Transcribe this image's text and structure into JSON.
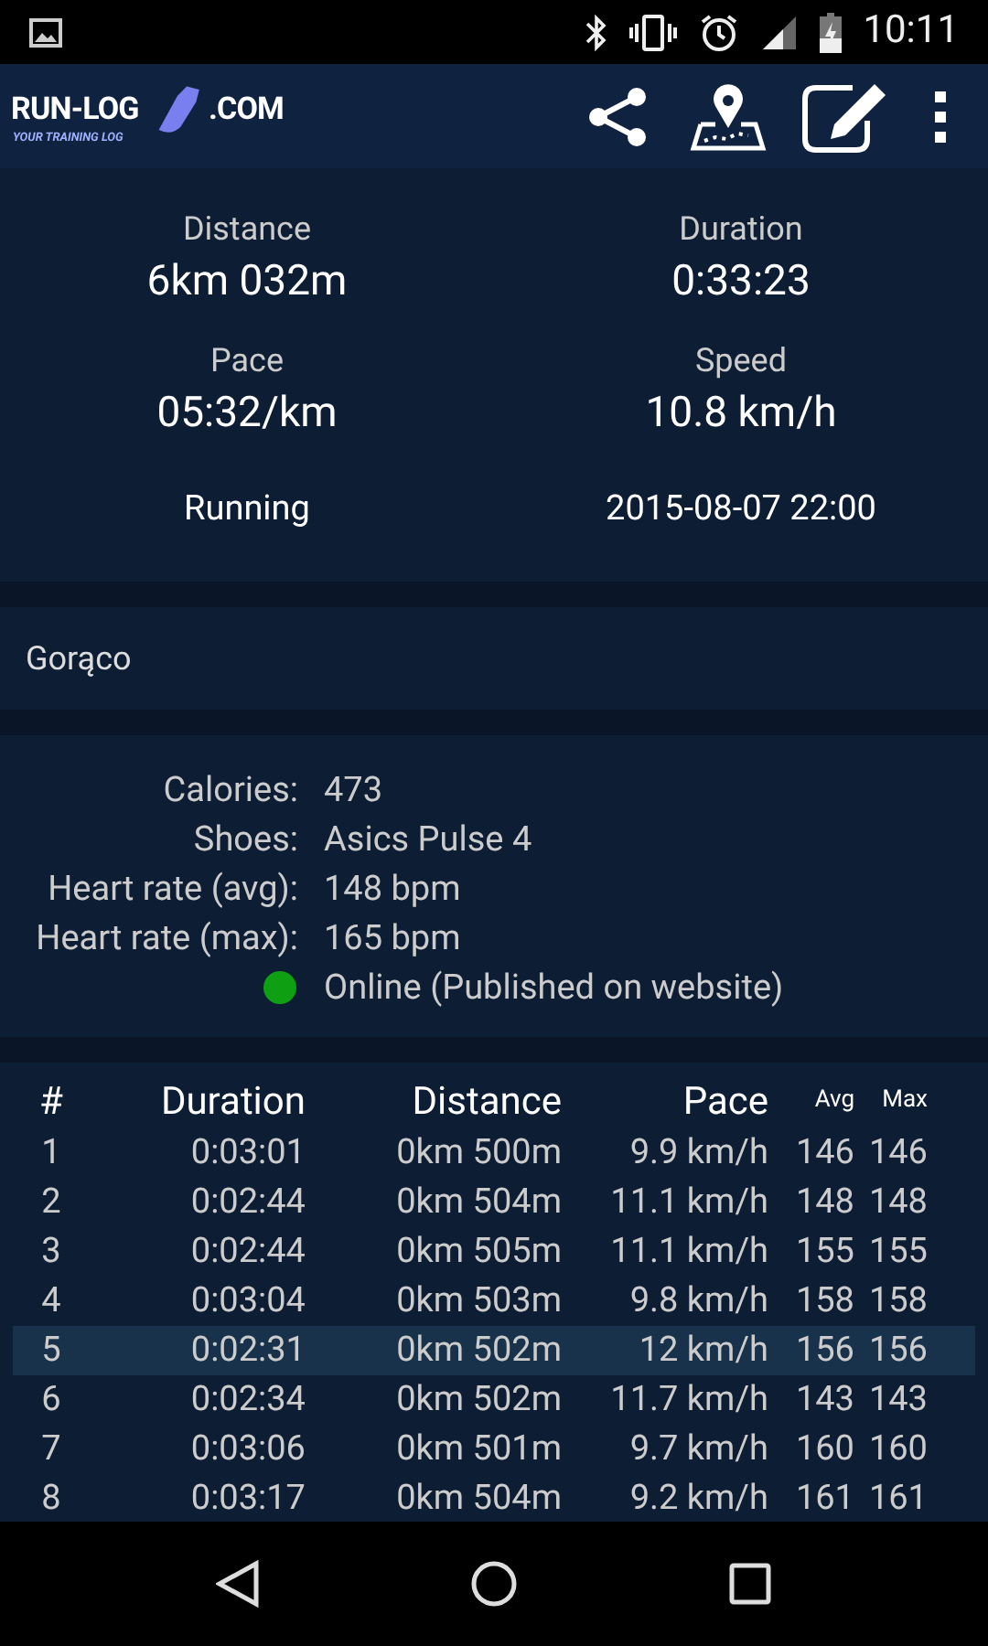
{
  "status_bar": {
    "time": "10:11"
  },
  "app_bar": {
    "logo": {
      "left": "RUN-LOG",
      "right": ".COM",
      "tagline": "YOUR TRAINING LOG"
    }
  },
  "summary": [
    {
      "label": "Distance",
      "value": "6km 032m"
    },
    {
      "label": "Duration",
      "value": "0:33:23"
    },
    {
      "label": "Pace",
      "value": "05:32/km"
    },
    {
      "label": "Speed",
      "value": "10.8 km/h"
    }
  ],
  "activity": {
    "type": "Running",
    "date": "2015-08-07 22:00"
  },
  "note": "Gorąco",
  "details": [
    {
      "label": "Calories:",
      "value": "473"
    },
    {
      "label": "Shoes:",
      "value": "Asics Pulse 4"
    },
    {
      "label": "Heart rate (avg):",
      "value": "148 bpm"
    },
    {
      "label": "Heart rate (max):",
      "value": "165 bpm"
    }
  ],
  "publish": {
    "text": "Online (Published on website)",
    "color": "#0ea012"
  },
  "laps": {
    "columns": [
      "#",
      "Duration",
      "Distance",
      "Pace",
      "Avg",
      "Max"
    ],
    "rows": [
      {
        "cells": [
          "1",
          "0:03:01",
          "0km 500m",
          "9.9 km/h",
          "146",
          "146"
        ],
        "selected": false
      },
      {
        "cells": [
          "2",
          "0:02:44",
          "0km 504m",
          "11.1 km/h",
          "148",
          "148"
        ],
        "selected": false
      },
      {
        "cells": [
          "3",
          "0:02:44",
          "0km 505m",
          "11.1 km/h",
          "155",
          "155"
        ],
        "selected": false
      },
      {
        "cells": [
          "4",
          "0:03:04",
          "0km 503m",
          "9.8 km/h",
          "158",
          "158"
        ],
        "selected": false
      },
      {
        "cells": [
          "5",
          "0:02:31",
          "0km 502m",
          "12 km/h",
          "156",
          "156"
        ],
        "selected": true
      },
      {
        "cells": [
          "6",
          "0:02:34",
          "0km 502m",
          "11.7 km/h",
          "143",
          "143"
        ],
        "selected": false
      },
      {
        "cells": [
          "7",
          "0:03:06",
          "0km 501m",
          "9.7 km/h",
          "160",
          "160"
        ],
        "selected": false
      },
      {
        "cells": [
          "8",
          "0:03:17",
          "0km 504m",
          "9.2 km/h",
          "161",
          "161"
        ],
        "selected": false
      }
    ]
  }
}
